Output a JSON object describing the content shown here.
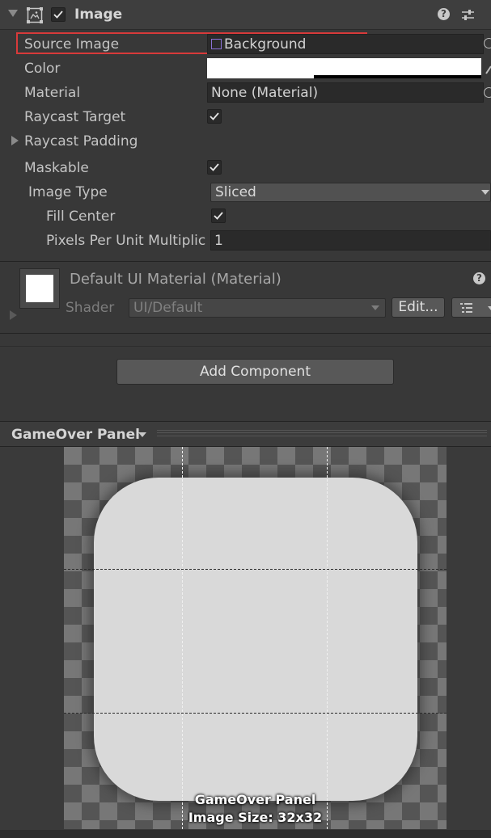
{
  "component": {
    "title": "Image",
    "enabled": true
  },
  "properties": {
    "source_image": {
      "label": "Source Image",
      "value": "Background"
    },
    "color": {
      "label": "Color"
    },
    "material": {
      "label": "Material",
      "value": "None (Material)"
    },
    "raycast_target": {
      "label": "Raycast Target",
      "checked": true
    },
    "raycast_padding": {
      "label": "Raycast Padding"
    },
    "maskable": {
      "label": "Maskable",
      "checked": true
    },
    "image_type": {
      "label": "Image Type",
      "value": "Sliced"
    },
    "fill_center": {
      "label": "Fill Center",
      "checked": true
    },
    "pixels_per_unit": {
      "label": "Pixels Per Unit Multiplic",
      "value": "1"
    }
  },
  "material_panel": {
    "title": "Default UI Material (Material)",
    "shader_label": "Shader",
    "shader_value": "UI/Default",
    "edit_label": "Edit..."
  },
  "add_component": {
    "label": "Add Component"
  },
  "preview": {
    "header_label": "GameOver Panel",
    "caption_name": "GameOver Panel",
    "caption_size": "Image Size: 32x32"
  },
  "colors": {
    "highlight_border": "#d83a3a",
    "background": "#383838"
  }
}
